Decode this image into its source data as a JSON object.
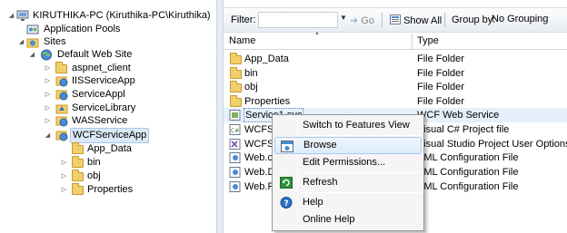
{
  "tree": {
    "items": [
      {
        "label": "KIRUTHIKA-PC (Kiruthika-PC\\Kiruthika)",
        "expander": "◢",
        "icon": "server-icon"
      },
      {
        "label": "Application Pools",
        "expander": "",
        "icon": "app-pools-icon"
      },
      {
        "label": "Sites",
        "expander": "◢",
        "icon": "sites-folder-icon"
      },
      {
        "label": "Default Web Site",
        "expander": "◢",
        "icon": "globe-icon"
      },
      {
        "label": "aspnet_client",
        "expander": "▷",
        "icon": "folder-icon"
      },
      {
        "label": "IISServiceApp",
        "expander": "▷",
        "icon": "web-application-icon"
      },
      {
        "label": "ServiceAppl",
        "expander": "▷",
        "icon": "web-application-icon"
      },
      {
        "label": "ServiceLibrary",
        "expander": "▷",
        "icon": "virtual-directory-icon"
      },
      {
        "label": "WASService",
        "expander": "▷",
        "icon": "web-application-icon"
      },
      {
        "label": "WCFServiceApp",
        "expander": "◢",
        "icon": "web-application-icon"
      },
      {
        "label": "App_Data",
        "expander": "",
        "icon": "folder-icon"
      },
      {
        "label": "bin",
        "expander": "▷",
        "icon": "folder-icon"
      },
      {
        "label": "obj",
        "expander": "▷",
        "icon": "folder-icon"
      },
      {
        "label": "Properties",
        "expander": "▷",
        "icon": "folder-icon"
      }
    ]
  },
  "toolbar": {
    "filter_label": "Filter:",
    "filter_value": "",
    "go_label": "Go",
    "show_all_label": "Show All",
    "group_by_label": "Group by:",
    "group_by_value": "No Grouping"
  },
  "list": {
    "columns": {
      "name": "Name",
      "type": "Type"
    },
    "rows": [
      {
        "name": "App_Data",
        "type": "File Folder",
        "icon": "folder-icon"
      },
      {
        "name": "bin",
        "type": "File Folder",
        "icon": "folder-icon"
      },
      {
        "name": "obj",
        "type": "File Folder",
        "icon": "folder-icon"
      },
      {
        "name": "Properties",
        "type": "File Folder",
        "icon": "folder-icon"
      },
      {
        "name": "Service1.svc",
        "type": "WCF Web Service",
        "icon": "svc-file-icon"
      },
      {
        "name": "WCFService...",
        "type": "Visual C# Project file",
        "icon": "csproj-file-icon"
      },
      {
        "name": "WCFService...",
        "type": "Visual Studio Project User Options file",
        "icon": "vs-user-file-icon"
      },
      {
        "name": "Web.config",
        "type": "XML Configuration File",
        "icon": "config-file-icon"
      },
      {
        "name": "Web.Debug.config",
        "type": "XML Configuration File",
        "icon": "config-file-icon"
      },
      {
        "name": "Web.Release.config",
        "type": "XML Configuration File",
        "icon": "config-file-icon"
      }
    ]
  },
  "context_menu": {
    "items": [
      {
        "label": "Switch to Features View",
        "icon": ""
      },
      {
        "label": "Browse",
        "icon": "browse-icon"
      },
      {
        "label": "Edit Permissions...",
        "icon": ""
      },
      {
        "label": "Refresh",
        "icon": "refresh-icon"
      },
      {
        "label": "Help",
        "icon": "help-icon"
      },
      {
        "label": "Online Help",
        "icon": ""
      }
    ]
  },
  "colors": {
    "selection": "#dbe9f7",
    "menu_highlight": "#dcebfb",
    "folder": "#f2cf6b"
  }
}
